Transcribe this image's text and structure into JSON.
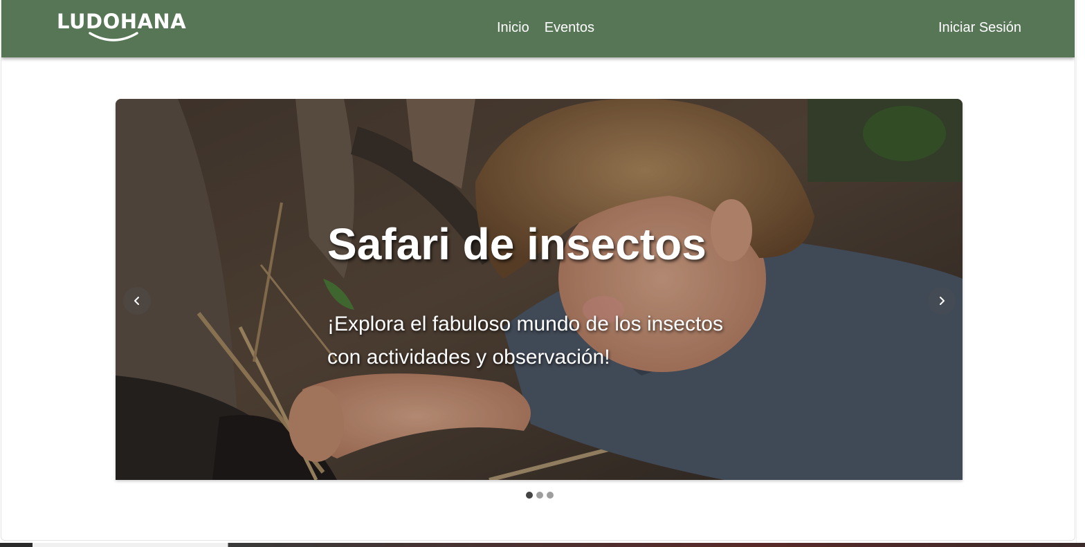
{
  "brand": {
    "name": "LUDOHANA",
    "color": "#577656"
  },
  "nav": {
    "links": [
      "Inicio",
      "Eventos"
    ],
    "login_label": "Iniciar Sesión"
  },
  "carousel": {
    "active_index": 0,
    "slide_count": 3,
    "slide": {
      "title": "Safari de insectos",
      "description": "¡Explora el fabuloso mundo de los insectos con actividades y observación!"
    },
    "prev_icon": "chevron-left-icon",
    "next_icon": "chevron-right-icon"
  }
}
